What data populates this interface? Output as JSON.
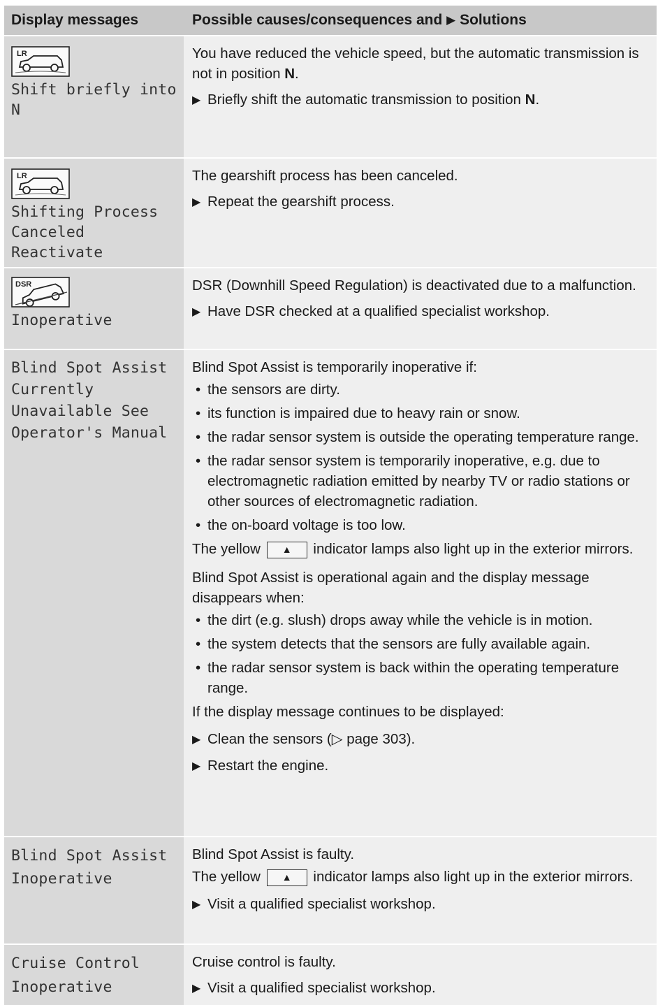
{
  "header": {
    "col1": "Display messages",
    "col2": "Possible causes/consequences and",
    "col2_solutions": "Solutions"
  },
  "icons": {
    "lr": "LR",
    "dsr": "DSR",
    "lamp_symbol": "▲"
  },
  "rows": [
    {
      "message": "Shift briefly into N",
      "text1": "You have reduced the vehicle speed, but the automatic transmission is not in position",
      "text1_bold": "N",
      "text1_end": ".",
      "step1": "Briefly shift the automatic transmission to position",
      "step1_bold": "N",
      "step1_end": "."
    },
    {
      "message": "Shifting Process Canceled Reactivate",
      "text1": "The gearshift process has been canceled.",
      "step1": "Repeat the gearshift process."
    },
    {
      "message": "Inoperative",
      "text1": "DSR (Downhill Speed Regulation) is deactivated due to a malfunction.",
      "step1": "Have DSR checked at a qualified specialist workshop."
    },
    {
      "message": "Blind Spot Assist Currently Unavailable See Operator's Manual",
      "text1": "Blind Spot Assist is temporarily inoperative if:",
      "bullets1": [
        "the sensors are dirty.",
        "its function is impaired due to heavy rain or snow.",
        "the radar sensor system is outside the operating temperature range.",
        "the radar sensor system is temporarily inoperative, e.g. due to electromagnetic radiation emitted by nearby TV or radio stations or other sources of electromagnetic radiation.",
        "the on-board voltage is too low."
      ],
      "lamp_pre": "The yellow",
      "lamp_post": "indicator lamps also light up in the exterior mirrors.",
      "text2": "Blind Spot Assist is operational again and the display message disappears when:",
      "bullets2": [
        "the dirt (e.g. slush) drops away while the vehicle is in motion.",
        "the system detects that the sensors are fully available again.",
        "the radar sensor system is back within the operating temperature range."
      ],
      "text3": "If the display message continues to be displayed:",
      "step1": "Clean the sensors (▷ page 303).",
      "step2": "Restart the engine."
    },
    {
      "message": "Blind Spot Assist Inoperative",
      "text1": "Blind Spot Assist is faulty.",
      "lamp_pre": "The yellow",
      "lamp_post": "indicator lamps also light up in the exterior mirrors.",
      "step1": "Visit a qualified specialist workshop."
    },
    {
      "message": "Cruise Control Inoperative",
      "text1": "Cruise control is faulty.",
      "step1": "Visit a qualified specialist workshop."
    }
  ]
}
